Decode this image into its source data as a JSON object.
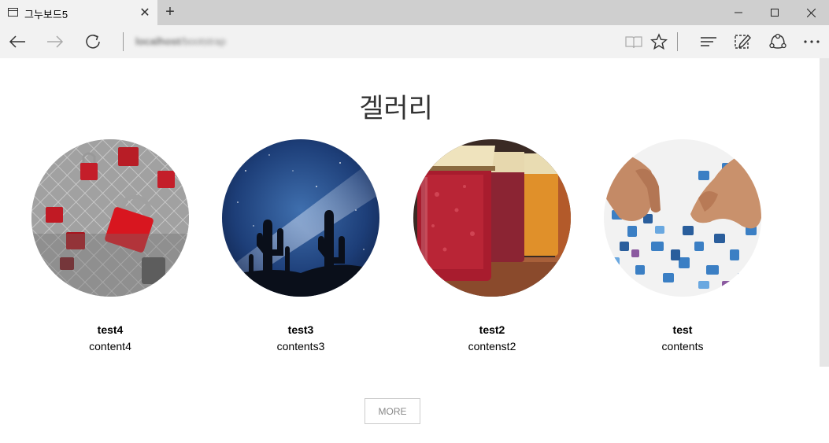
{
  "browser": {
    "tab_title": "그누보드5",
    "url_host": "localhost",
    "url_path": "/bootstrap"
  },
  "page": {
    "heading": "겔러리",
    "more_label": "MORE"
  },
  "gallery": [
    {
      "title": "test4",
      "content": "content4",
      "image": "padlocks-on-fence"
    },
    {
      "title": "test3",
      "content": "contents3",
      "image": "night-sky-cactus"
    },
    {
      "title": "test2",
      "content": "contenst2",
      "image": "jam-jars"
    },
    {
      "title": "test",
      "content": "contents",
      "image": "puzzle-pieces"
    }
  ]
}
